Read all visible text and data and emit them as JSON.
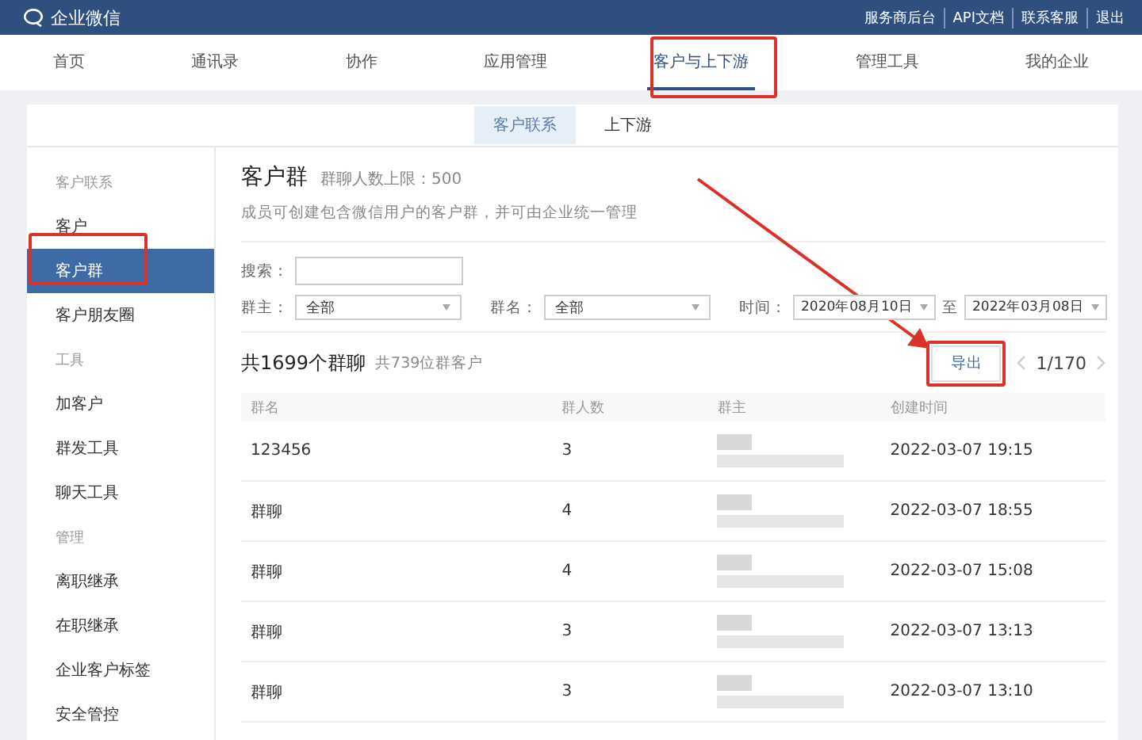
{
  "top_bar": {
    "logo_text": "企业微信",
    "links": [
      "服务商后台",
      "API文档",
      "联系客服",
      "退出"
    ]
  },
  "nav_tabs": [
    {
      "label": "首页",
      "selected": false
    },
    {
      "label": "通讯录",
      "selected": false
    },
    {
      "label": "协作",
      "selected": false
    },
    {
      "label": "应用管理",
      "selected": false
    },
    {
      "label": "客户与上下游",
      "selected": true
    },
    {
      "label": "管理工具",
      "selected": false
    },
    {
      "label": "我的企业",
      "selected": false
    }
  ],
  "sub_tabs": [
    {
      "label": "客户联系",
      "selected": true
    },
    {
      "label": "上下游",
      "selected": false
    }
  ],
  "sidebar": {
    "sections": [
      {
        "title": "客户联系",
        "items": [
          {
            "label": "客户",
            "selected": false
          },
          {
            "label": "客户群",
            "selected": true
          },
          {
            "label": "客户朋友圈",
            "selected": false
          }
        ]
      },
      {
        "title": "工具",
        "items": [
          {
            "label": "加客户",
            "selected": false
          },
          {
            "label": "群发工具",
            "selected": false
          },
          {
            "label": "聊天工具",
            "selected": false
          }
        ]
      },
      {
        "title": "管理",
        "items": [
          {
            "label": "离职继承",
            "selected": false
          },
          {
            "label": "在职继承",
            "selected": false
          },
          {
            "label": "企业客户标签",
            "selected": false
          },
          {
            "label": "安全管控",
            "selected": false
          }
        ]
      }
    ]
  },
  "page": {
    "title": "客户群",
    "limit": "群聊人数上限：500",
    "description": "成员可创建包含微信用户的客户群，并可由企业统一管理"
  },
  "filters": {
    "search_label": "搜索：",
    "owner_label": "群主：",
    "owner_value": "全部",
    "name_label": "群名：",
    "name_value": "全部",
    "time_label": "时间：",
    "date_from": "2020年08月10日",
    "to_label": "至",
    "date_to": "2022年03月08日"
  },
  "summary": {
    "count": "共1699个群聊",
    "customers": "共739位群客户",
    "export": "导出",
    "pagination": "1/170"
  },
  "table": {
    "columns": [
      "群名",
      "群人数",
      "群主",
      "创建时间"
    ],
    "rows": [
      {
        "name": "123456",
        "members": "3",
        "created": "2022-03-07 19:15"
      },
      {
        "name": "群聊",
        "members": "4",
        "created": "2022-03-07 18:55"
      },
      {
        "name": "群聊",
        "members": "4",
        "created": "2022-03-07 15:08"
      },
      {
        "name": "群聊",
        "members": "3",
        "created": "2022-03-07 13:13"
      },
      {
        "name": "群聊",
        "members": "3",
        "created": "2022-03-07 13:10"
      }
    ]
  }
}
